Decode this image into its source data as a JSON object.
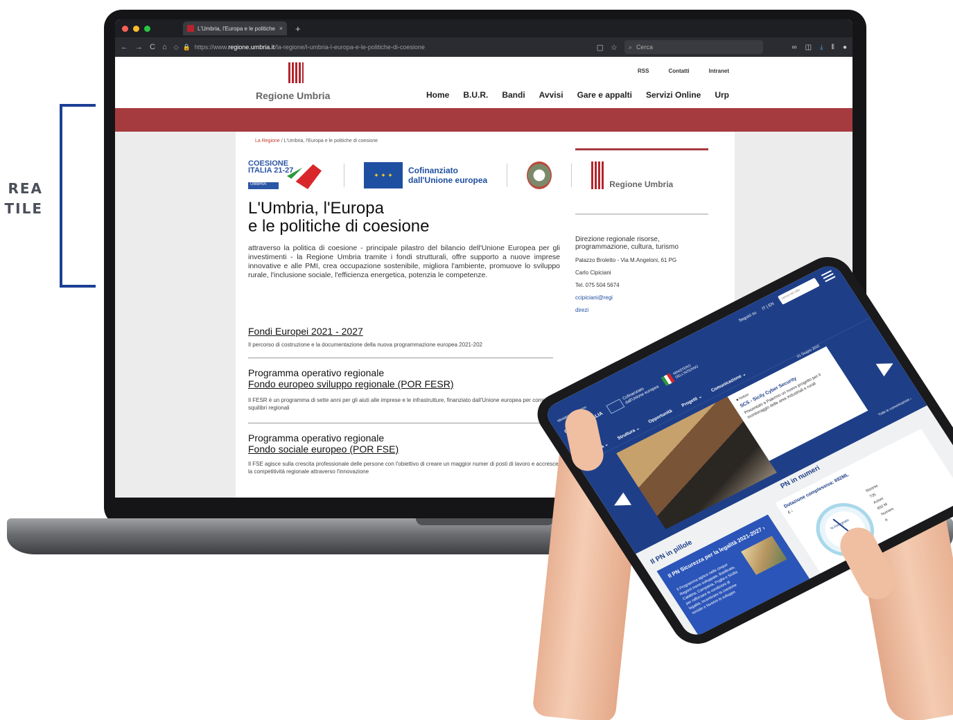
{
  "side_label": {
    "line1": "REA",
    "line2": "TILE"
  },
  "browser": {
    "tab_title": "L'Umbria, l'Europa e le politiche",
    "tab_close": "×",
    "new_tab": "+",
    "url_prefix": "https://www.",
    "url_host": "regione.umbria.it",
    "url_path": "/la-regione/l-umbria-l-europa-e-le-politiche-di-coesione",
    "search_placeholder": "Cerca",
    "nav_icons": [
      "back-icon",
      "forward-icon",
      "reload-icon",
      "home-icon",
      "shield-icon",
      "lock-icon"
    ]
  },
  "site": {
    "logo_text": "Regione Umbria",
    "top_links": [
      "RSS",
      "Contatti",
      "Intranet"
    ],
    "main_nav": [
      "Home",
      "B.U.R.",
      "Bandi",
      "Avvisi",
      "Gare e appalti",
      "Servizi Online",
      "Urp"
    ],
    "breadcrumb_link": "La Regione",
    "breadcrumb_current": " / L'Umbria, l'Europa e le politiche di coesione",
    "logos": {
      "coesione_1": "COESIONE",
      "coesione_2": "ITALIA 21-27",
      "coesione_region": "UMBRIA",
      "eu_1": "Cofinanziato",
      "eu_2": "dall'Unione europea",
      "ru": "Regione Umbria"
    },
    "title_line1": "L'Umbria, l'Europa",
    "title_line2": "e le politiche di coesione",
    "intro": "attraverso la politica di coesione - principale pilastro del bilancio dell'Unione Europea per gli investimenti - la Regione Umbria tramite i fondi strutturali, offre supporto a nuove imprese innovative e alle PMI, crea occupazione sostenibile, migliora l'ambiente, promuove lo sviluppo rurale, l'inclusione sociale, l'efficienza energetica, potenzia le competenze.",
    "sections": [
      {
        "title1": "Fondi Europei 2021 - 2027",
        "title2": "",
        "text": "Il percorso di costruzione e la documentazione della nuova programmazione europea 2021-202"
      },
      {
        "title1": "Programma operativo regionale",
        "title2": "Fondo europeo sviluppo regionale (POR FESR)",
        "text": "Il FESR è un programma di sette anni per gli aiuti alle imprese e le infrastrutture, finanziato dall'Unione europea per correggere gli squilibri regionali"
      },
      {
        "title1": "Programma operativo regionale",
        "title2": "Fondo sociale europeo (POR FSE)",
        "text": "Il FSE agisce sulla crescita professionale delle persone con l'obiettivo di creare un maggior numer di posti di lavoro e accrescere la competitività regionale attraverso l'innovazione"
      }
    ],
    "sidebar": {
      "title": "Direzione regionale risorse, programmazione, cultura, turismo",
      "address": "Palazzo Broletto - Via M.Angeloni, 61 PG",
      "person": "Carlo Cipiciani",
      "phone": "Tel. 075 504 5674",
      "email": "ccipiciani@regi",
      "email2": "direzi"
    }
  },
  "tablet": {
    "top_links": "Seguici su",
    "lang": "IT | EN",
    "search_placeholder": "cerca nel sito",
    "ministry_label": "Ministero dell'Interno",
    "coesione": "COESIONE ITALIA",
    "eu_1": "Cofinanziato",
    "eu_2": "dall'Unione europea",
    "ministry_1": "MINISTERO",
    "ministry_2": "DELL'INTERNO",
    "nav": [
      "Programma ⌄",
      "Struttura ⌄",
      "Opportunità",
      "Progetti ⌄",
      "Comunicazione ⌄"
    ],
    "news_tag": "■ Notizie",
    "news_date": "01 Giugno 2022",
    "news_title": "SCS - Sicily Cyber Security",
    "news_text": "Presentato a Palermo un nuovo progetto per il monitoraggio delle aree industriali e rurali",
    "all_news": "Tutte le comunicazioni ›",
    "prev": "◀",
    "next": "▶",
    "pillole_title": "Il PN in pillole",
    "card_title": "Il PN Sicurezza per la legalità 2021-2027 ›",
    "card_text": "Il Programma agisce nelle cinque Regioni meno sviluppate: Basilicata, Calabria, Campania, Puglia e Sicilia per rafforzare le condizioni di legalità, incentivare la coesione sociale e favorire lo sviluppo",
    "numeri_title": "PN in numeri",
    "dotazione": "Dotazione complessiva: 692ML",
    "stats_sub": "€ ›",
    "gauge_label": "% Assegnato",
    "gauge_num": "100",
    "stat_lines": [
      "Risorse",
      "735",
      "Azioni",
      "692 M",
      "Numero",
      "A"
    ]
  }
}
